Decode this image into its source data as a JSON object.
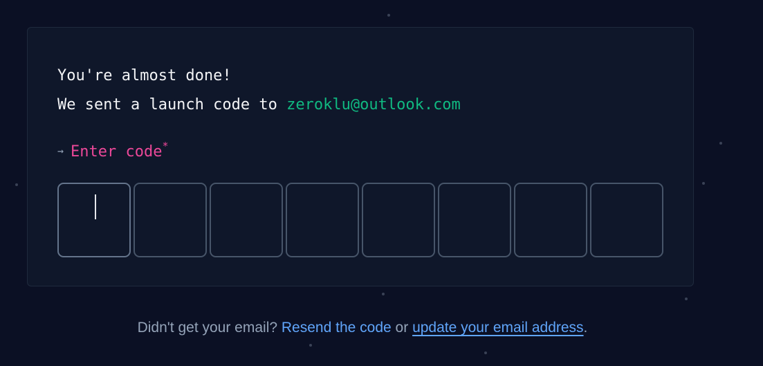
{
  "verify": {
    "heading_line1": "You're almost done!",
    "heading_line2_prefix": "We sent a launch code to",
    "email": "zeroklu@outlook.com",
    "code_label_arrow": "→",
    "code_label": "Enter code",
    "code_required_mark": "*",
    "code_digits": [
      "",
      "",
      "",
      "",
      "",
      "",
      "",
      ""
    ]
  },
  "footer": {
    "prompt": "Didn't get your email?",
    "resend_link": "Resend the code",
    "or_text": "or",
    "update_link": "update your email address",
    "period": "."
  },
  "colors": {
    "background": "#0b1024",
    "card": "#0f172a",
    "email_accent": "#10b981",
    "label_accent": "#ec4899",
    "link": "#60a5fa"
  }
}
